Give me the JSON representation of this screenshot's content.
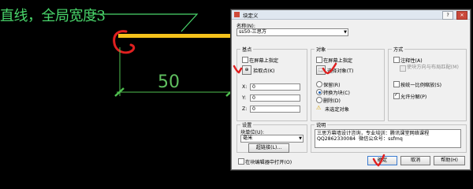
{
  "canvas": {
    "annotation_title": "直线，全局宽度3",
    "dimension_value": "50",
    "colors": {
      "background": "#000000",
      "line": "#f5c21b",
      "dimension": "#4fbf4f",
      "annotation": "#49d66b",
      "marker": "#e02020"
    }
  },
  "dialog": {
    "title": "块定义",
    "name_label": "名称(N):",
    "name_value": "ss50-三思方",
    "base_point": {
      "group_title": "基点",
      "specify_on_screen": "在屏幕上指定",
      "pick_point": "拾取点(K)",
      "x_label": "X:",
      "x_value": "0",
      "y_label": "Y:",
      "y_value": "0",
      "z_label": "Z:",
      "z_value": "0"
    },
    "objects": {
      "group_title": "对象",
      "specify_on_screen": "在屏幕上指定",
      "select_objects": "选择对象(T)",
      "retain": "保留(R)",
      "convert_to_block": "转换为块(C)",
      "delete": "删除(D)",
      "none_selected": "未选定对象"
    },
    "behavior": {
      "group_title": "方式",
      "annotative": "注释性(A)",
      "match_orientation": "使块方向与布局匹配(M)",
      "scale_uniformly": "按统一比例缩放(S)",
      "allow_exploding": "允许分解(P)"
    },
    "settings": {
      "group_title": "设置",
      "block_unit_label": "块单位(U):",
      "block_unit_value": "毫米",
      "hyperlink_button": "超链接(L)..."
    },
    "description": {
      "group_title": "说明",
      "text_line1": "三思方幕墙设计咨询，专业培训：腾讯课堂网络课程",
      "text_line2": "QQ2862330084  微信公众号：ssfmq"
    },
    "open_in_editor": "在块编辑器中打开(O)",
    "ok_button": "确定",
    "cancel_button": "取消",
    "help_button": "帮助(H)"
  }
}
